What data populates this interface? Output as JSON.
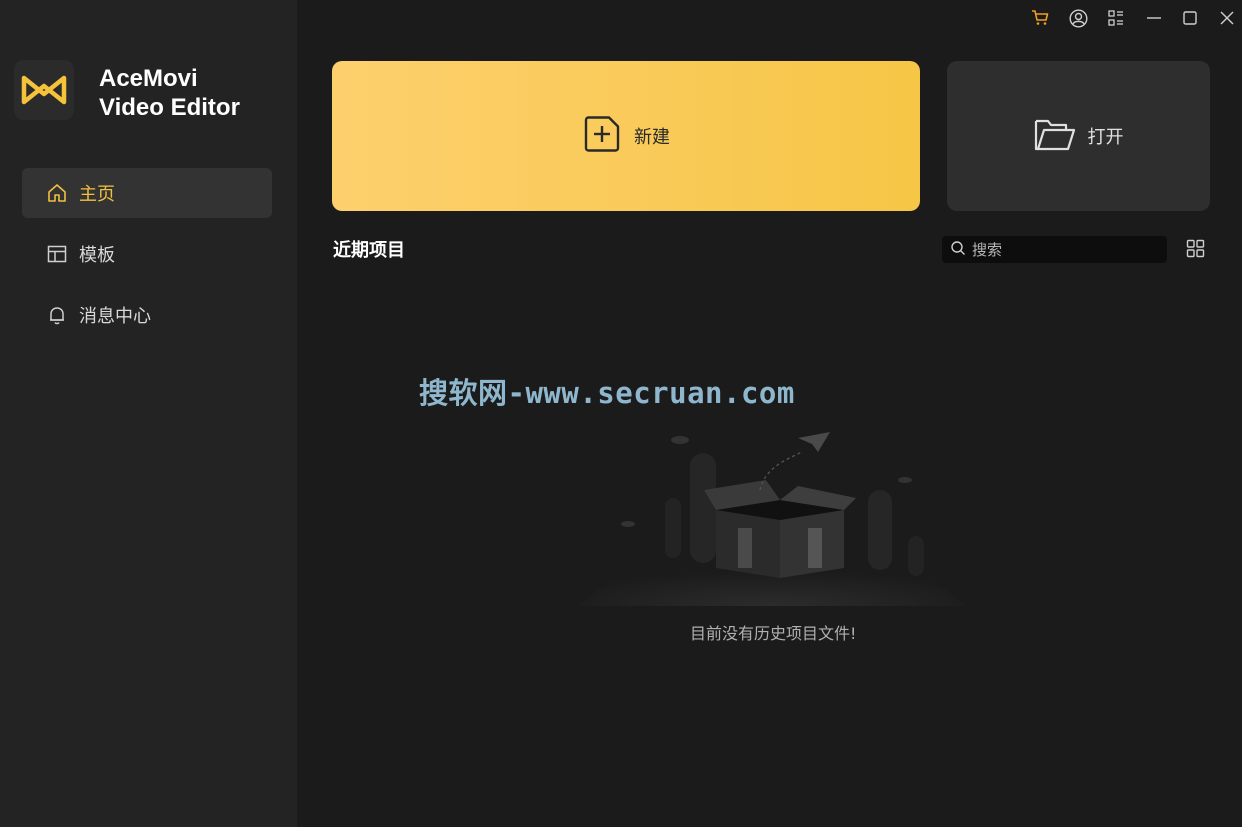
{
  "app": {
    "title_line1": "AceMovi",
    "title_line2": "Video Editor"
  },
  "sidebar": {
    "items": [
      {
        "label": "主页",
        "icon": "home-icon",
        "active": true
      },
      {
        "label": "模板",
        "icon": "template-icon",
        "active": false
      },
      {
        "label": "消息中心",
        "icon": "bell-icon",
        "active": false
      }
    ]
  },
  "titlebar": {
    "icons": [
      "cart-icon",
      "account-icon",
      "apps-icon",
      "minimize-icon",
      "maximize-icon",
      "close-icon"
    ]
  },
  "actions": {
    "new_label": "新建",
    "open_label": "打开"
  },
  "recent": {
    "title": "近期项目",
    "search_placeholder": "搜索",
    "empty_text": "目前没有历史项目文件!"
  },
  "watermark": "搜软网-www.secruan.com",
  "colors": {
    "accent": "#f0c040",
    "cart": "#f0a020"
  }
}
